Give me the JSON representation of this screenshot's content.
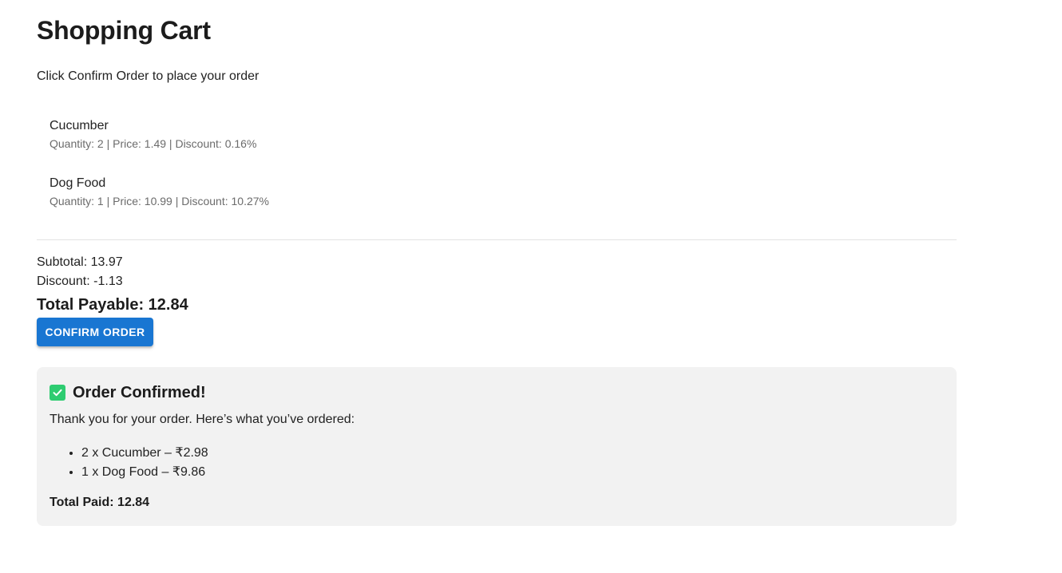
{
  "page": {
    "title": "Shopping Cart",
    "instruction": "Click Confirm Order to place your order"
  },
  "cart": {
    "items": [
      {
        "name": "Cucumber",
        "meta": "Quantity: 2 | Price: 1.49 | Discount: 0.16%"
      },
      {
        "name": "Dog Food",
        "meta": "Quantity: 1 | Price: 10.99 | Discount: 10.27%"
      }
    ]
  },
  "summary": {
    "subtotal": "Subtotal: 13.97",
    "discount": "Discount: -1.13",
    "total_payable": "Total Payable: 12.84"
  },
  "actions": {
    "confirm_label": "Confirm Order"
  },
  "confirmation": {
    "title": "Order Confirmed!",
    "message": "Thank you for your order. Here’s what you’ve ordered:",
    "items": [
      "2 x Cucumber – ₹2.98",
      "1 x Dog Food – ₹9.86"
    ],
    "total_paid": "Total Paid: 12.84",
    "icon": "check-square-icon",
    "icon_color": "#2ecc71"
  },
  "colors": {
    "primary_button": "#1976d2",
    "confirmation_bg": "#f2f2f2"
  }
}
